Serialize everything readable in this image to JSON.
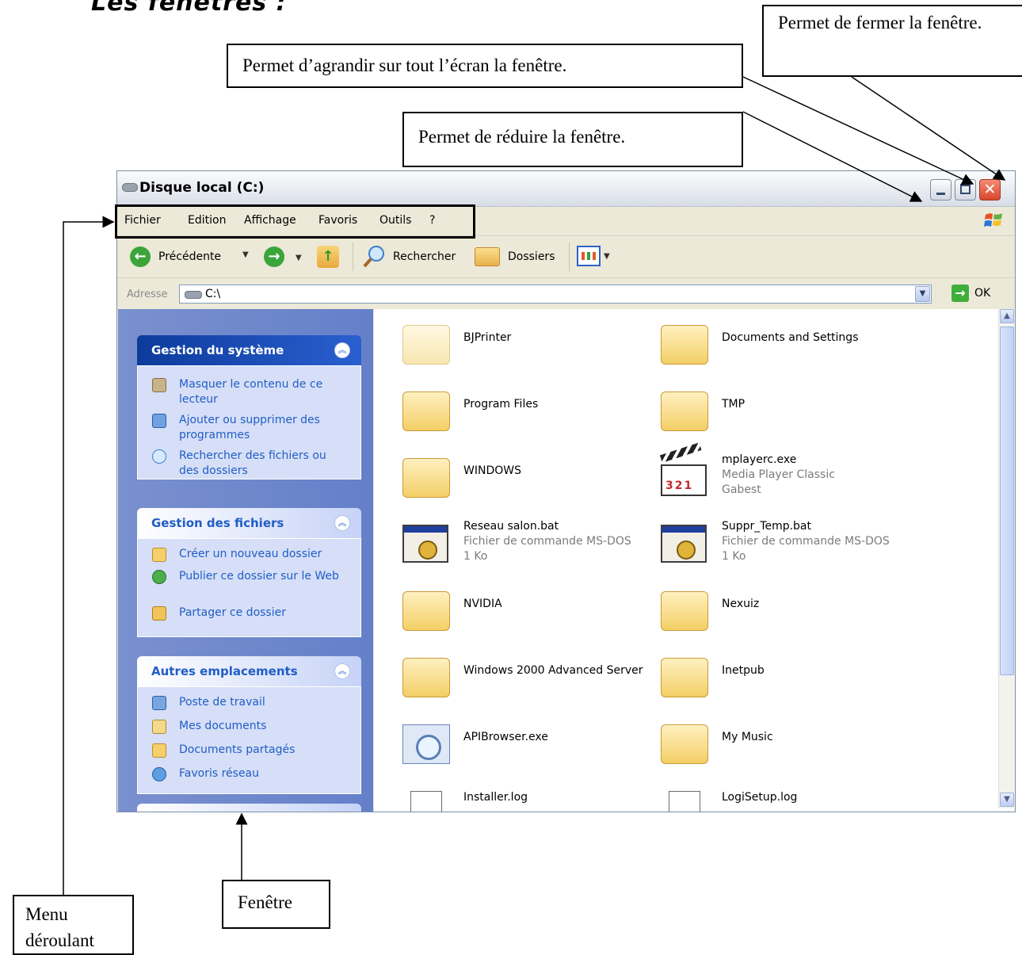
{
  "doc": {
    "heading": "Les fenêtres :"
  },
  "callouts": {
    "close": "Permet de fermer la fenêtre.",
    "maximize": "Permet d’agrandir sur tout l’écran la fenêtre.",
    "minimize": "Permet de réduire la fenêtre.",
    "menu": "Menu déroulant",
    "window": "Fenêtre"
  },
  "window": {
    "title": "Disque local (C:)"
  },
  "menu": [
    "Fichier",
    "Edition",
    "Affichage",
    "Favoris",
    "Outils",
    "?"
  ],
  "toolbar": {
    "back": "Précédente",
    "search": "Rechercher",
    "folders": "Dossiers"
  },
  "address": {
    "label": "Adresse",
    "value": "C:\\",
    "go": "OK"
  },
  "panels": [
    {
      "title": "Gestion du système",
      "tasks": [
        "Masquer le contenu de ce lecteur",
        "Ajouter ou supprimer des programmes",
        "Rechercher des fichiers ou des dossiers"
      ]
    },
    {
      "title": "Gestion des fichiers",
      "tasks": [
        "Créer un nouveau dossier",
        "Publier ce dossier sur le Web",
        "Partager ce dossier"
      ]
    },
    {
      "title": "Autres emplacements",
      "tasks": [
        "Poste de travail",
        "Mes documents",
        "Documents partagés",
        "Favoris réseau"
      ]
    }
  ],
  "files": [
    {
      "name": "BJPrinter"
    },
    {
      "name": "Documents and Settings"
    },
    {
      "name": "Program Files"
    },
    {
      "name": "TMP"
    },
    {
      "name": "WINDOWS"
    },
    {
      "name": "mplayerc.exe",
      "line2": "Media Player Classic",
      "line3": "Gabest",
      "clapper": "321"
    },
    {
      "name": "Reseau salon.bat",
      "line2": "Fichier de commande MS-DOS",
      "line3": "1 Ko"
    },
    {
      "name": "Suppr_Temp.bat",
      "line2": "Fichier de commande MS-DOS",
      "line3": "1 Ko"
    },
    {
      "name": "NVIDIA"
    },
    {
      "name": "Nexuiz"
    },
    {
      "name": "Windows 2000 Advanced Server"
    },
    {
      "name": "Inetpub"
    },
    {
      "name": "APIBrowser.exe"
    },
    {
      "name": "My Music"
    },
    {
      "name": "Installer.log"
    },
    {
      "name": "LogiSetup.log"
    }
  ]
}
